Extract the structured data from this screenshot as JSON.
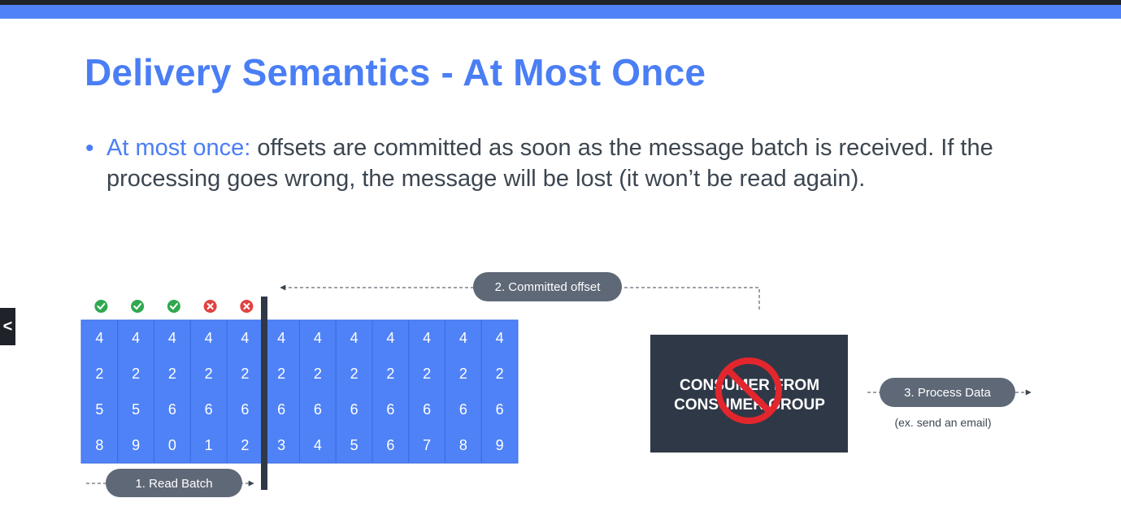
{
  "slide": {
    "title": "Delivery Semantics - At Most Once",
    "bullet": {
      "term": "At most once:",
      "text": " offsets are committed as soon as the message batch is received. If the processing goes wrong, the message will be lost (it won’t be read again)."
    }
  },
  "nav": {
    "prev_icon": "chevron-left-icon",
    "prev_glyph": "<"
  },
  "diagram": {
    "offsets": [
      "4258",
      "4259",
      "4260",
      "4261",
      "4262",
      "4263",
      "4264",
      "4265",
      "4266",
      "4267",
      "4268",
      "4269"
    ],
    "status": [
      "success",
      "success",
      "success",
      "failure",
      "failure"
    ],
    "labels": {
      "read_batch": "1. Read Batch",
      "committed_offset": "2. Committed offset",
      "process_data": "3. Process Data",
      "process_note": "(ex. send an email)",
      "consumer_line1": "CONSUMER FROM",
      "consumer_line2": "CONSUMER GROUP"
    },
    "colors": {
      "cells": "#4f82f7",
      "cell_border": "#3a6be0",
      "pill": "#5f6877",
      "consumer_box": "#2f3847",
      "success": "#2fa84f",
      "failure": "#e0433f",
      "forbidden": "#e3262d",
      "commit_marker": "#2f3847"
    }
  }
}
